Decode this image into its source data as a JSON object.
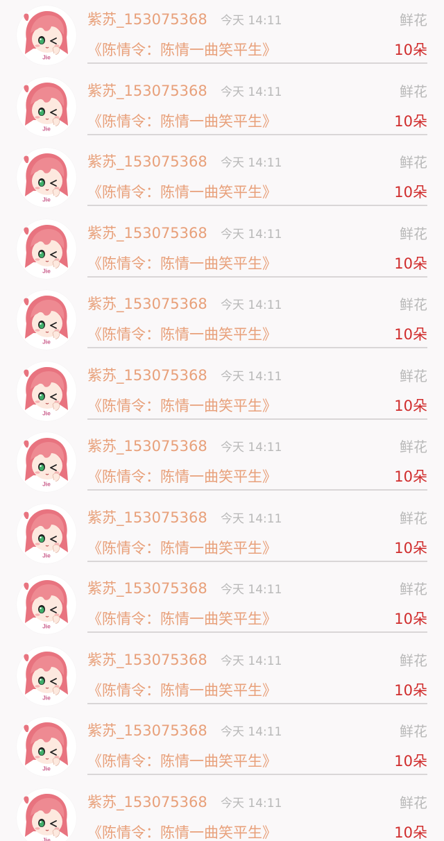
{
  "gift_list": {
    "items": [
      {
        "user": "紫苏_153075368",
        "time": "今天 14:11",
        "gift": "鲜花",
        "book": "《陈情令：陈情一曲笑平生》",
        "count": "10朵"
      },
      {
        "user": "紫苏_153075368",
        "time": "今天 14:11",
        "gift": "鲜花",
        "book": "《陈情令：陈情一曲笑平生》",
        "count": "10朵"
      },
      {
        "user": "紫苏_153075368",
        "time": "今天 14:11",
        "gift": "鲜花",
        "book": "《陈情令：陈情一曲笑平生》",
        "count": "10朵"
      },
      {
        "user": "紫苏_153075368",
        "time": "今天 14:11",
        "gift": "鲜花",
        "book": "《陈情令：陈情一曲笑平生》",
        "count": "10朵"
      },
      {
        "user": "紫苏_153075368",
        "time": "今天 14:11",
        "gift": "鲜花",
        "book": "《陈情令：陈情一曲笑平生》",
        "count": "10朵"
      },
      {
        "user": "紫苏_153075368",
        "time": "今天 14:11",
        "gift": "鲜花",
        "book": "《陈情令：陈情一曲笑平生》",
        "count": "10朵"
      },
      {
        "user": "紫苏_153075368",
        "time": "今天 14:11",
        "gift": "鲜花",
        "book": "《陈情令：陈情一曲笑平生》",
        "count": "10朵"
      },
      {
        "user": "紫苏_153075368",
        "time": "今天 14:11",
        "gift": "鲜花",
        "book": "《陈情令：陈情一曲笑平生》",
        "count": "10朵"
      },
      {
        "user": "紫苏_153075368",
        "time": "今天 14:11",
        "gift": "鲜花",
        "book": "《陈情令：陈情一曲笑平生》",
        "count": "10朵"
      },
      {
        "user": "紫苏_153075368",
        "time": "今天 14:11",
        "gift": "鲜花",
        "book": "《陈情令：陈情一曲笑平生》",
        "count": "10朵"
      },
      {
        "user": "紫苏_153075368",
        "time": "今天 14:11",
        "gift": "鲜花",
        "book": "《陈情令：陈情一曲笑平生》",
        "count": "10朵"
      },
      {
        "user": "紫苏_153075368",
        "time": "今天 14:11",
        "gift": "鲜花",
        "book": "《陈情令：陈情一曲笑平生》",
        "count": "10朵"
      }
    ],
    "avatar_badge": "Jie"
  },
  "colors": {
    "username": "#e8a07a",
    "book_title": "#e8a07a",
    "meta_gray": "#b8b8b8",
    "count_red": "#d02c2c",
    "divider": "#d9d6d7",
    "background": "#faf8f9"
  },
  "icons": {
    "avatar": "anime-girl-avatar-icon"
  }
}
